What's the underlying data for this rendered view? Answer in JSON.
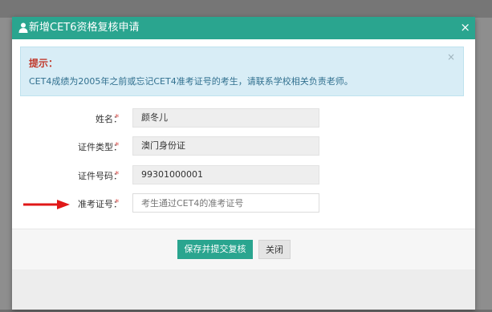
{
  "modal": {
    "title": "新增CET6资格复核申请",
    "header_icon": "user-icon",
    "close_symbol": "×"
  },
  "alert": {
    "title": "提示：",
    "text": "CET4成绩为2005年之前或忘记CET4准考证号的考生，请联系学校相关负责老师。",
    "close_symbol": "×"
  },
  "form": {
    "required_mark": "*",
    "name": {
      "label": "姓名：",
      "value": "颜冬儿"
    },
    "id_type": {
      "label": "证件类型：",
      "value": "澳门身份证"
    },
    "id_number": {
      "label": "证件号码：",
      "value": "99301000001"
    },
    "exam_number": {
      "label": "准考证号：",
      "value": "",
      "placeholder": "考生通过CET4的准考证号"
    }
  },
  "footer": {
    "submit_label": "保存并提交复核",
    "close_label": "关闭"
  },
  "colors": {
    "accent": "#2aa58f",
    "alert_bg": "#d8edf6",
    "alert_title": "#c0392b",
    "required": "#d9534f",
    "annotation_arrow": "#e01818"
  },
  "annotation": {
    "arrow_icon": "red-arrow-icon"
  }
}
